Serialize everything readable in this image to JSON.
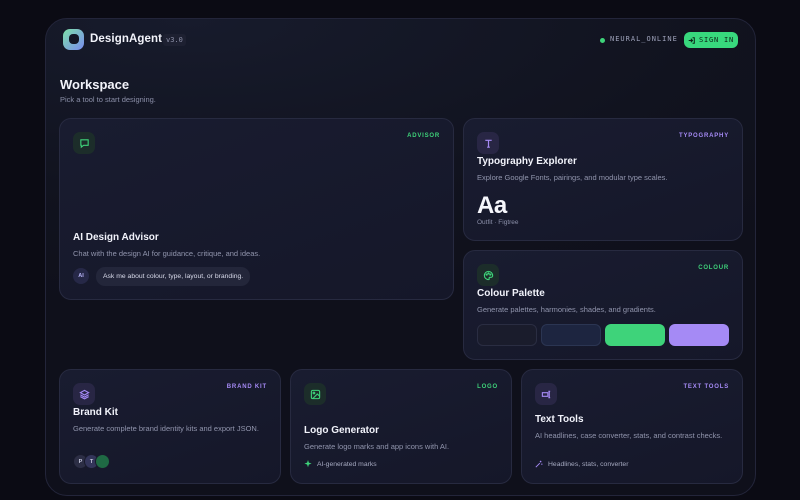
{
  "header": {
    "brand": "DesignAgent",
    "version": "v3.0",
    "status": "NEURAL_ONLINE",
    "signin_label": "SIGN IN"
  },
  "page": {
    "title": "Workspace",
    "subtitle": "Pick a tool to start designing."
  },
  "cards": {
    "advisor": {
      "tag": "ADVISOR",
      "title": "AI Design Advisor",
      "desc": "Chat with the design AI for guidance, critique, and ideas.",
      "badge": "AI",
      "prompt": "Ask me about colour, type, layout, or branding."
    },
    "typography": {
      "tag": "TYPOGRAPHY",
      "title": "Typography Explorer",
      "desc": "Explore Google Fonts, pairings, and modular type scales.",
      "sample": "Aa",
      "fonts": "Outfit · Figtree"
    },
    "colour": {
      "tag": "COLOUR",
      "title": "Colour Palette",
      "desc": "Generate palettes, harmonies, shades, and gradients.",
      "swatches": [
        "#1a1c2c",
        "#1d2540",
        "#3ed37a",
        "#a58af5"
      ]
    },
    "brandkit": {
      "tag": "BRAND KIT",
      "title": "Brand Kit",
      "desc": "Generate complete brand identity kits and export JSON.",
      "avatars": [
        "P",
        "T",
        ""
      ]
    },
    "logo": {
      "tag": "LOGO",
      "title": "Logo Generator",
      "desc": "Generate logo marks and app icons with AI.",
      "meta": "AI-generated marks"
    },
    "texttools": {
      "tag": "TEXT TOOLS",
      "title": "Text Tools",
      "desc": "AI headlines, case converter, stats, and contrast checks.",
      "meta": "Headlines, stats, converter"
    }
  },
  "colors": {
    "accent_green": "#3ed37a",
    "accent_purple": "#a58af5",
    "background": "#0b0b14"
  }
}
